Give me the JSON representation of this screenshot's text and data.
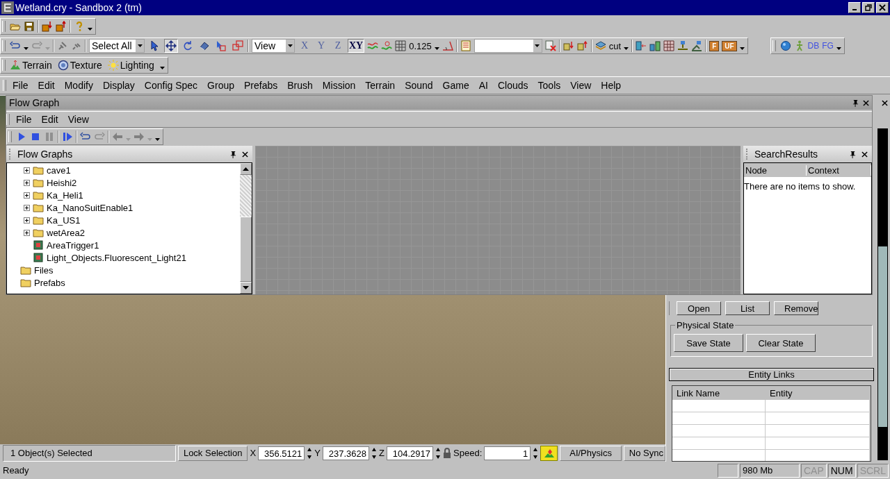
{
  "window": {
    "title": "Wetland.cry - Sandbox 2 (tm)"
  },
  "toolbar_edit": {
    "selection_set": "Select All",
    "tools": [
      {
        "kind": "select",
        "selected": false
      },
      {
        "kind": "move",
        "selected": true
      },
      {
        "kind": "rotate",
        "selected": false
      },
      {
        "kind": "scale",
        "selected": false
      },
      {
        "kind": "region",
        "selected": false
      },
      {
        "kind": "box",
        "selected": false
      }
    ],
    "coord_system": "View",
    "axes": [
      {
        "label": "X",
        "selected": false
      },
      {
        "label": "Y",
        "selected": false
      },
      {
        "label": "Z",
        "selected": false
      },
      {
        "label": "XY",
        "selected": true
      }
    ],
    "grid_size": "0.125",
    "layer": "cut"
  },
  "toolbar_badges": [
    "F",
    "UF"
  ],
  "toolbar_debug": [
    "DB",
    "FG"
  ],
  "toolbar_modes": [
    {
      "label": "Terrain",
      "kind": "terrain"
    },
    {
      "label": "Texture",
      "kind": "texture"
    },
    {
      "label": "Lighting",
      "kind": "lighting"
    }
  ],
  "menu": [
    "File",
    "Edit",
    "Modify",
    "Display",
    "Config Spec",
    "Group",
    "Prefabs",
    "Brush",
    "Mission",
    "Terrain",
    "Sound",
    "Game",
    "AI",
    "Clouds",
    "Tools",
    "View",
    "Help"
  ],
  "flow_graph": {
    "title": "Flow Graph",
    "menu": [
      "File",
      "Edit",
      "View"
    ],
    "tree_panel": {
      "title": "Flow Graphs",
      "tree": [
        {
          "children": [
            {
              "label": "cave1",
              "kind": "folder",
              "expanded": false
            },
            {
              "label": "Heishi2",
              "kind": "folder",
              "expanded": false
            },
            {
              "label": "Ka_Heli1",
              "kind": "folder",
              "expanded": false
            },
            {
              "label": "Ka_NanoSuitEnable1",
              "kind": "folder",
              "expanded": false
            },
            {
              "label": "Ka_US1",
              "kind": "folder",
              "expanded": false
            },
            {
              "label": "wetArea2",
              "kind": "folder",
              "expanded": false
            },
            {
              "label": "AreaTrigger1",
              "kind": "entity"
            },
            {
              "label": "Light_Objects.Fluorescent_Light21",
              "kind": "entity"
            }
          ]
        },
        {
          "label": "Files",
          "kind": "folder"
        },
        {
          "label": "Prefabs",
          "kind": "folder"
        }
      ]
    },
    "search_panel": {
      "title": "SearchResults",
      "columns": [
        "Node",
        "Context"
      ],
      "empty_message": "There are no items to show."
    }
  },
  "properties_panel": {
    "entity_buttons": [
      "Open",
      "List",
      "Remove"
    ],
    "physical_state": {
      "title": "Physical State",
      "buttons": [
        "Save State",
        "Clear State"
      ]
    },
    "entity_links": {
      "title": "Entity Links",
      "columns": [
        "Link Name",
        "Entity"
      ]
    }
  },
  "viewport_bar": {
    "selection_info": "1 Object(s) Selected",
    "lock_button": "Lock Selection",
    "coords": [
      {
        "label": "X",
        "value": "356.5121"
      },
      {
        "label": "Y",
        "value": "237.3628"
      },
      {
        "label": "Z",
        "value": "104.2917"
      }
    ],
    "speed_label": "Speed:",
    "speed": "1",
    "mode_button": "AI/Physics",
    "sync_button": "No Sync"
  },
  "status_bar": {
    "message": "Ready",
    "memory": "980 Mb",
    "indicators": [
      {
        "label": "CAP",
        "on": false
      },
      {
        "label": "NUM",
        "on": true
      },
      {
        "label": "SCRL",
        "on": false
      }
    ]
  }
}
